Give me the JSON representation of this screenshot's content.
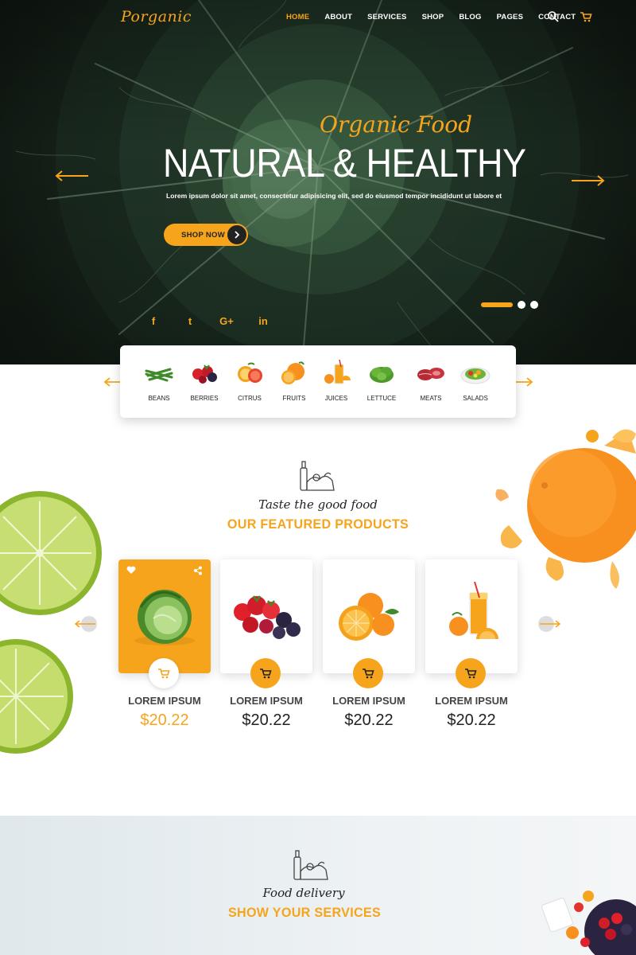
{
  "brand": {
    "logo": "Porganic",
    "accent": "#f7a41d"
  },
  "nav": {
    "items": [
      {
        "label": "HOME",
        "active": true
      },
      {
        "label": "ABOUT",
        "active": false
      },
      {
        "label": "SERVICES",
        "active": false
      },
      {
        "label": "SHOP",
        "active": false
      },
      {
        "label": "BLOG",
        "active": false
      },
      {
        "label": "PAGES",
        "active": false
      },
      {
        "label": "CONTACT",
        "active": false
      }
    ],
    "icons": [
      "search-icon",
      "cart-icon"
    ]
  },
  "hero": {
    "script": "Organic Food",
    "title": "NATURAL & HEALTHY",
    "subtitle": "Lorem ipsum dolor sit amet, consectetur adipisicing elit, sed do eiusmod tempor incididunt ut labore et",
    "cta": "SHOP NOW",
    "slides": {
      "count": 3,
      "active": 1
    },
    "social": [
      "f",
      "t",
      "G+",
      "in"
    ]
  },
  "categories": [
    {
      "label": "BEANS",
      "icon": "beans-icon"
    },
    {
      "label": "BERRIES",
      "icon": "berries-icon"
    },
    {
      "label": "CITRUS",
      "icon": "citrus-icon"
    },
    {
      "label": "FRUITS",
      "icon": "fruits-icon"
    },
    {
      "label": "JUICES",
      "icon": "juices-icon"
    },
    {
      "label": "LETTUCE",
      "icon": "lettuce-icon"
    },
    {
      "label": "MEATS",
      "icon": "meats-icon"
    },
    {
      "label": "SALADS",
      "icon": "salads-icon"
    }
  ],
  "featured": {
    "script": "Taste the good food",
    "title": "OUR FEATURED PRODUCTS",
    "products": [
      {
        "name": "LOREM IPSUM",
        "price": "$20.22",
        "image": "cabbage",
        "active": true
      },
      {
        "name": "LOREM IPSUM",
        "price": "$20.22",
        "image": "berries",
        "active": false
      },
      {
        "name": "LOREM IPSUM",
        "price": "$20.22",
        "image": "oranges",
        "active": false
      },
      {
        "name": "LOREM IPSUM",
        "price": "$20.22",
        "image": "juice",
        "active": false
      }
    ]
  },
  "services": {
    "script": "Food delivery",
    "title": "SHOW YOUR SERVICES"
  }
}
